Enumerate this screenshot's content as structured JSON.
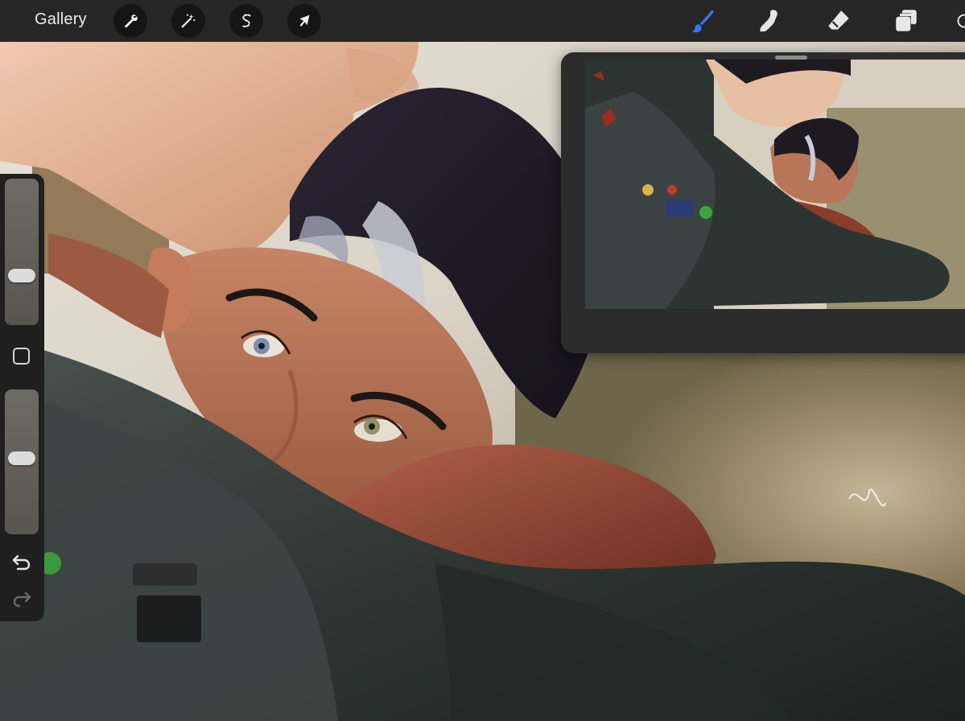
{
  "toolbar": {
    "gallery_label": "Gallery",
    "left_tools": [
      {
        "name": "actions",
        "icon": "wrench-icon"
      },
      {
        "name": "adjustments",
        "icon": "magic-wand-icon"
      },
      {
        "name": "selection",
        "icon": "selection-s-icon"
      },
      {
        "name": "transform",
        "icon": "arrow-cursor-icon"
      }
    ],
    "right_tools": [
      {
        "name": "brush",
        "icon": "brush-icon",
        "active": true,
        "color": "#2f7cf6"
      },
      {
        "name": "smudge",
        "icon": "smudge-finger-icon",
        "active": false
      },
      {
        "name": "eraser",
        "icon": "eraser-icon",
        "active": false
      },
      {
        "name": "layers",
        "icon": "layers-icon",
        "active": false
      },
      {
        "name": "color",
        "icon": "color-circle-icon",
        "active": false
      }
    ]
  },
  "sidebar": {
    "brush_size": 0.32,
    "brush_opacity": 0.53,
    "modify_icon": "square-modify-icon",
    "undo_icon": "undo-arrow-icon",
    "redo_icon": "redo-arrow-icon"
  },
  "reference_panel": {
    "title": "",
    "handle_icon": "drag-handle-icon",
    "image_description_icon": "reference-artwork"
  },
  "colors": {
    "toolbar_bg": "#262626",
    "accent": "#2f7cf6",
    "panel_bg": "#2c2c2c"
  }
}
